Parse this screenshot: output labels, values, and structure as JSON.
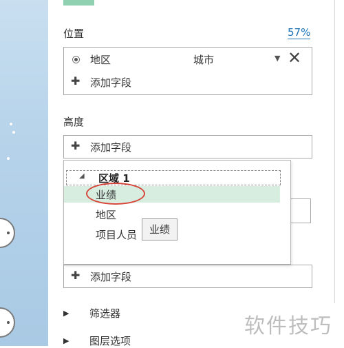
{
  "location": {
    "label": "位置",
    "percent": "57%",
    "field": {
      "name": "地区",
      "type": "城市"
    },
    "add_field": "添加字段"
  },
  "height": {
    "label": "高度",
    "add_field": "添加字段"
  },
  "popup": {
    "header": "区域 1",
    "items": [
      "业绩",
      "地区",
      "项目人员"
    ]
  },
  "tooltip": "业绩",
  "lower": {
    "add_field": "添加字段"
  },
  "collapsibles": [
    "筛选器",
    "图层选项"
  ],
  "watermark": "软件技巧",
  "colors": {
    "accent": "#1b73b8",
    "selection": "#d6ede0",
    "highlight_ellipse": "#d6463a"
  }
}
